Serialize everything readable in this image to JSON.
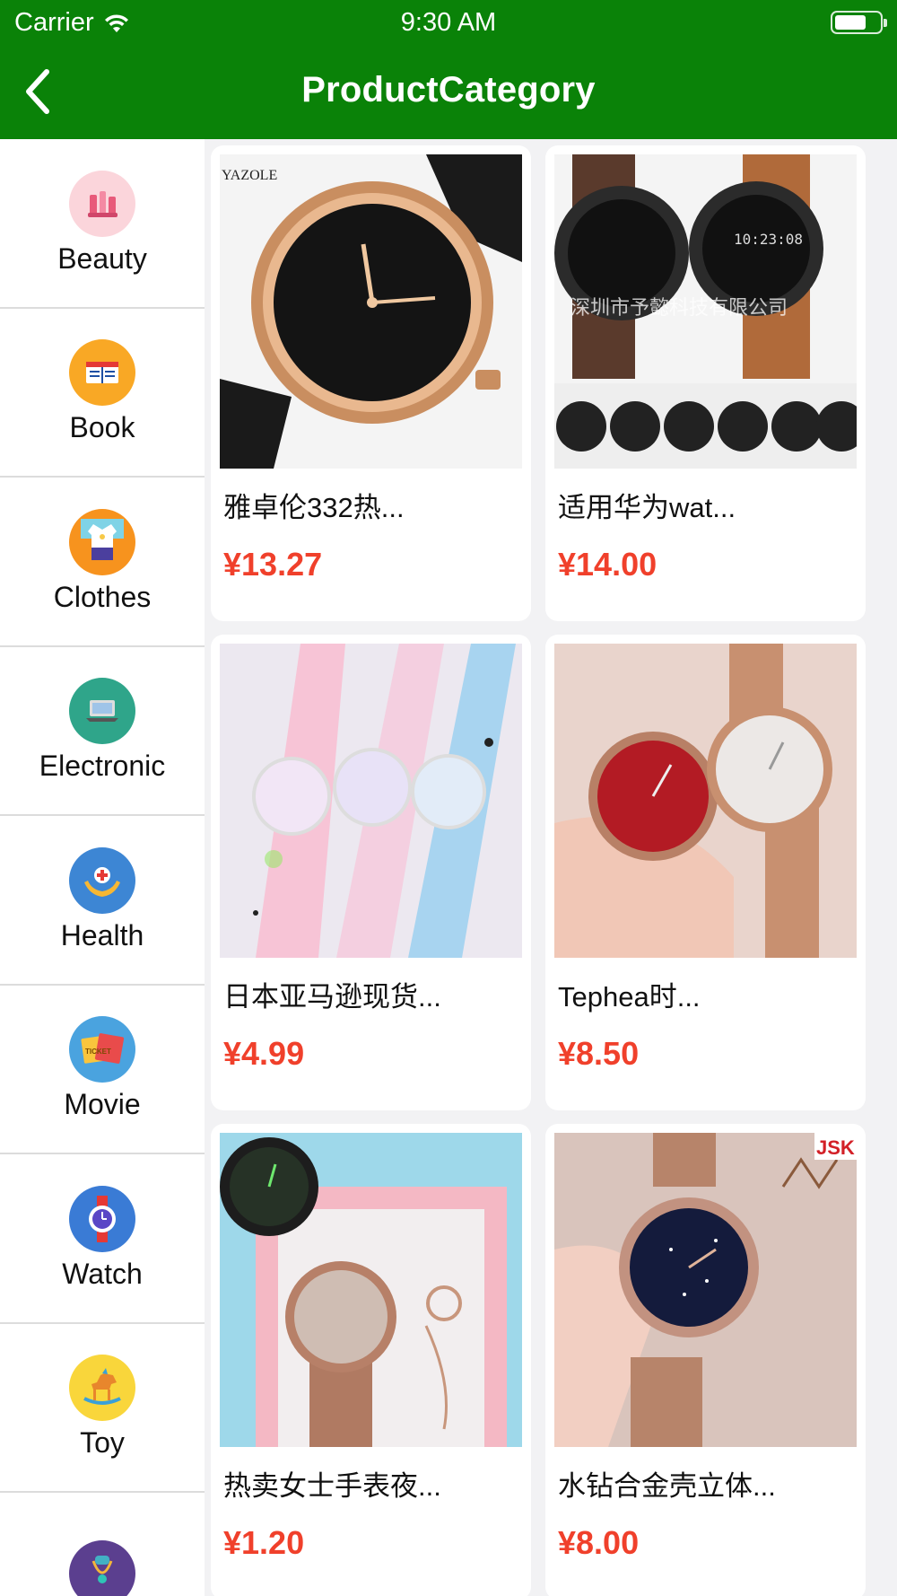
{
  "status": {
    "carrier": "Carrier",
    "time": "9:30 AM"
  },
  "nav": {
    "title": "ProductCategory",
    "back_icon": "chevron-left-icon"
  },
  "colors": {
    "header": "#0a8208",
    "price": "#f0402b"
  },
  "categories": [
    {
      "label": "Beauty",
      "icon": "beauty-icon"
    },
    {
      "label": "Book",
      "icon": "book-icon"
    },
    {
      "label": "Clothes",
      "icon": "clothes-icon"
    },
    {
      "label": "Electronic",
      "icon": "laptop-icon"
    },
    {
      "label": "Health",
      "icon": "health-icon"
    },
    {
      "label": "Movie",
      "icon": "ticket-icon"
    },
    {
      "label": "Watch",
      "icon": "watch-icon"
    },
    {
      "label": "Toy",
      "icon": "rocking-horse-icon"
    },
    {
      "label": "",
      "icon": "necklace-icon"
    }
  ],
  "products": [
    {
      "name": "雅卓伦332热...",
      "price": "¥13.27",
      "brand": "YAZOLE"
    },
    {
      "name": "适用华为wat...",
      "price": "¥14.00",
      "watermark": "深圳市予懿科技有限公司"
    },
    {
      "name": "日本亚马逊现货...",
      "price": "¥4.99"
    },
    {
      "name": "Tephea时...",
      "price": "¥8.50"
    },
    {
      "name": "热卖女士手表夜...",
      "price": "¥1.20"
    },
    {
      "name": "水钻合金壳立体...",
      "price": "¥8.00",
      "brand": "JSK"
    }
  ]
}
